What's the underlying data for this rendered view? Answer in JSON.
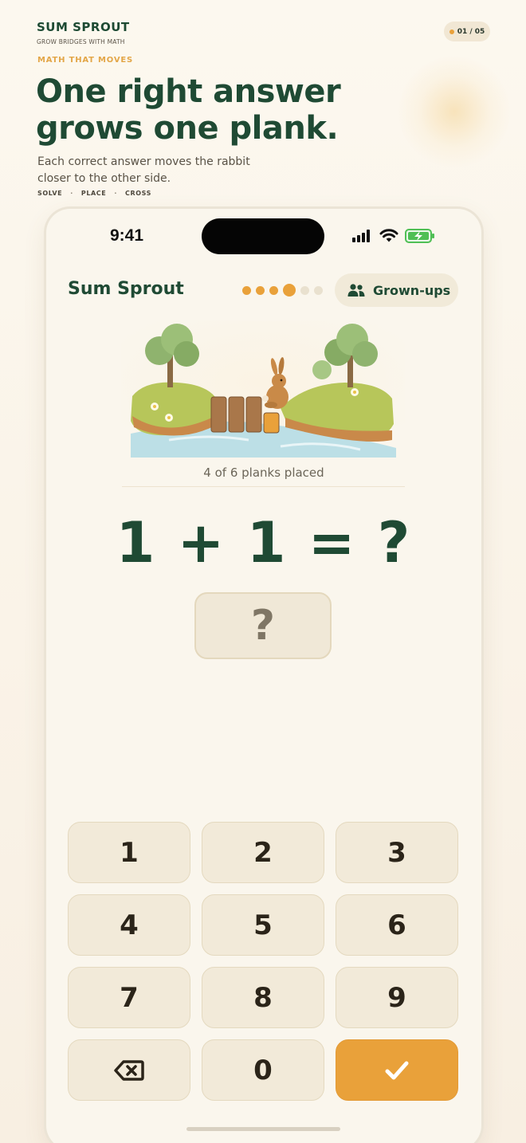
{
  "header": {
    "brand": "SUM SPROUT",
    "tagline": "GROW BRIDGES WITH MATH",
    "pager": "01 / 05",
    "eyebrow": "MATH THAT MOVES",
    "headline_line1": "One right answer",
    "headline_line2": "grows one plank.",
    "blurb": "Each correct answer moves the rabbit closer to the other side.",
    "steps": [
      "SOLVE",
      "PLACE",
      "CROSS"
    ],
    "step_separator": "·"
  },
  "status_bar": {
    "time": "9:41",
    "icons": [
      "cellular-signal-icon",
      "wifi-icon",
      "battery-charging-icon"
    ]
  },
  "app": {
    "title": "Sum Sprout",
    "progress": {
      "completed": 3,
      "current": 4,
      "total": 6
    },
    "grownups_label": "Grown-ups",
    "grownups_icon": "people-icon"
  },
  "scene": {
    "planks_placed": 4,
    "planks_total": 6,
    "caption": "4 of 6 planks placed"
  },
  "problem": {
    "equation": "1 + 1 = ?",
    "answer_placeholder": "?"
  },
  "keypad": {
    "keys": [
      "1",
      "2",
      "3",
      "4",
      "5",
      "6",
      "7",
      "8",
      "9"
    ],
    "zero": "0",
    "backspace_icon": "backspace-icon",
    "submit_icon": "checkmark-icon"
  },
  "colors": {
    "brand_green": "#1f4a34",
    "accent_orange": "#e9a13a",
    "key_bg": "#f2ead9",
    "page_bg": "#fcf8ef"
  }
}
